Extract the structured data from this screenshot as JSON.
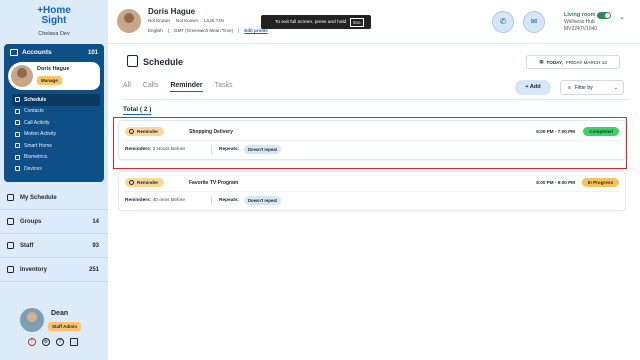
{
  "sidebar": {
    "logo_line1": "+Home",
    "logo_line2": "Sight",
    "org": "Chelsea Dev",
    "accounts": {
      "label": "Accounts",
      "count": "101",
      "person": {
        "name": "Doris Hague",
        "role": "Manage"
      },
      "items": [
        {
          "label": "Schedule",
          "active": true
        },
        {
          "label": "Contacts"
        },
        {
          "label": "Call Activity"
        },
        {
          "label": "Motion Activity"
        },
        {
          "label": "Smart Home"
        },
        {
          "label": "Biometrics"
        },
        {
          "label": "Devices"
        }
      ]
    },
    "nav": [
      {
        "label": "My Schedule",
        "count": ""
      },
      {
        "label": "Groups",
        "count": "14"
      },
      {
        "label": "Staff",
        "count": "93"
      },
      {
        "label": "Inventory",
        "count": "251"
      }
    ],
    "user": {
      "name": "Dean",
      "role": "Staff Admin"
    }
  },
  "topbar": {
    "name": "Doris Hague",
    "meta": [
      "Not Known",
      "Not Known",
      "LS25 7JN"
    ],
    "lang": "English",
    "timezone": "GMT (Greenwich Mean Time)",
    "edit_link": "Edit profile",
    "toast": "To exit full screen, press and hold",
    "toast_key": "Esc",
    "hub_room": "Living room",
    "hub_name": "Wellness Hub",
    "hub_id": "MV2247V1040"
  },
  "main": {
    "title": "Schedule",
    "date_bold": "TODAY,",
    "date_rest": "FRIDAY MARCH 13",
    "tabs": [
      "All",
      "Calls",
      "Reminder",
      "Tasks"
    ],
    "active_tab": "Reminder",
    "add_label": "Add",
    "filter_label": "Filter by",
    "total": "Total ( 2 )",
    "cards": [
      {
        "tag": "Reminder",
        "title": "Shopping Delivery",
        "time": "6:00 PM - 7:00 PM",
        "status": "Completed",
        "reminders_label": "Reminders:",
        "reminders_value": "2 Hours Before",
        "repeats_label": "Repeats:",
        "repeats_value": "Doesn't repeat"
      },
      {
        "tag": "Reminder",
        "title": "Favorite TV Program",
        "time": "8:00 PM - 9:00 PM",
        "status": "In Progress",
        "reminders_label": "Reminders:",
        "reminders_value": "40 mins Before",
        "repeats_label": "Repeats:",
        "repeats_value": "Doesn't repeat"
      }
    ]
  },
  "colors": {
    "accent": "#1565c0",
    "sidebar_dark": "#0d4f86",
    "completed": "#3ecf6e",
    "in_progress": "#f4c15d",
    "highlight": "#e0242e"
  }
}
